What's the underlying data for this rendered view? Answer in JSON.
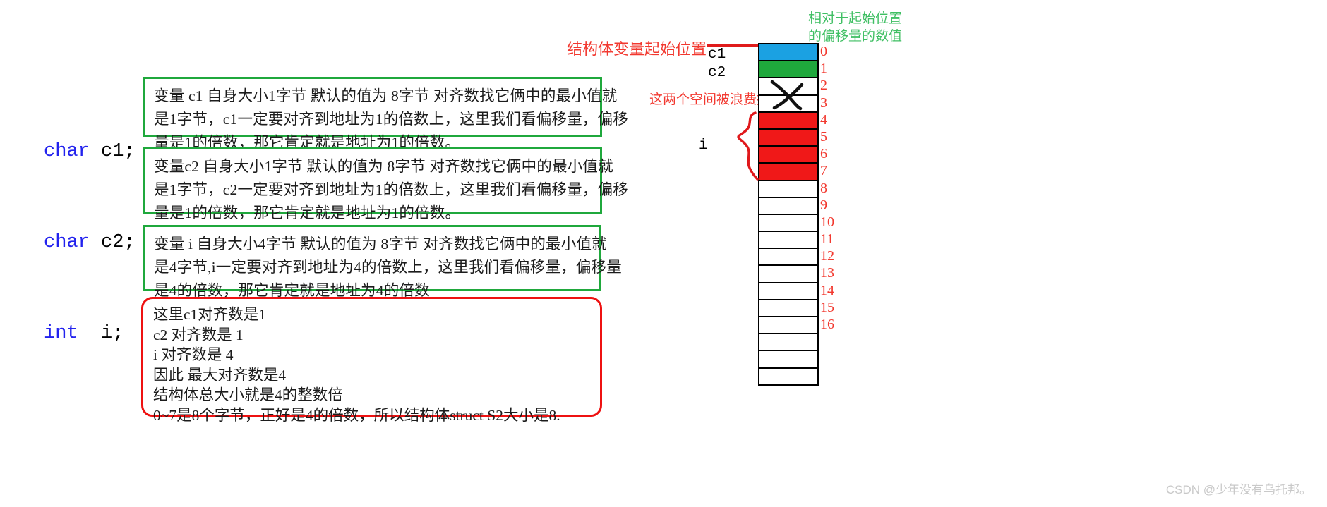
{
  "code": {
    "lines": [
      {
        "keyword": "char",
        "rest": " c1;"
      },
      {
        "keyword": "char",
        "rest": " c2;"
      },
      {
        "keyword": "int",
        "rest": "  i;"
      }
    ]
  },
  "green_boxes": [
    {
      "name": "explanation-c1",
      "lines": [
        "变量 c1 自身大小1字节 默认的值为 8字节 对齐数找它俩中的最小值就",
        "是1字节，c1一定要对齐到地址为1的倍数上，这里我们看偏移量，偏移",
        "量是1的倍数，那它肯定就是地址为1的倍数。"
      ]
    },
    {
      "name": "explanation-c2",
      "lines": [
        "变量c2 自身大小1字节 默认的值为 8字节 对齐数找它俩中的最小值就",
        "是1字节，c2一定要对齐到地址为1的倍数上，这里我们看偏移量，偏移",
        "量是1的倍数，那它肯定就是地址为1的倍数。"
      ]
    },
    {
      "name": "explanation-i",
      "lines": [
        "变量 i 自身大小4字节 默认的值为 8字节 对齐数找它俩中的最小值就",
        "是4字节,i一定要对齐到地址为4的倍数上，这里我们看偏移量，偏移量",
        "是4的倍数，那它肯定就是地址为4的倍数"
      ]
    }
  ],
  "red_box": {
    "name": "conclusion-box",
    "lines": [
      "这里c1对齐数是1",
      "c2 对齐数是 1",
      "i 对齐数是 4",
      "因此 最大对齐数是4",
      "结构体总大小就是4的整数倍",
      "0~7是8个字节，正好是4的倍数，所以结构体struct S2大小是8."
    ]
  },
  "annotations": {
    "start_position": "结构体变量起始位置",
    "wasted_space": "这两个空间被浪费掉了",
    "offset_legend": "相对于起始位置\n的偏移量的数值"
  },
  "variable_labels": {
    "c1": "c1",
    "c2": "c2",
    "i": "i"
  },
  "memory": {
    "offsets": [
      "0",
      "1",
      "2",
      "3",
      "4",
      "5",
      "6",
      "7",
      "8",
      "9",
      "10",
      "11",
      "12",
      "13",
      "14",
      "15",
      "16"
    ],
    "total_cells": 20,
    "cells": [
      {
        "offset": "0",
        "fill": "#1ba1e2",
        "owner": "c1"
      },
      {
        "offset": "1",
        "fill": "#1fa83c",
        "owner": "c2"
      },
      {
        "offset": "2",
        "fill": "#ffffff",
        "owner": "padding"
      },
      {
        "offset": "3",
        "fill": "#ffffff",
        "owner": "padding"
      },
      {
        "offset": "4",
        "fill": "#f01818",
        "owner": "i"
      },
      {
        "offset": "5",
        "fill": "#f01818",
        "owner": "i"
      },
      {
        "offset": "6",
        "fill": "#f01818",
        "owner": "i"
      },
      {
        "offset": "7",
        "fill": "#f01818",
        "owner": "i"
      },
      {
        "offset": "8",
        "fill": "#ffffff",
        "owner": ""
      },
      {
        "offset": "9",
        "fill": "#ffffff",
        "owner": ""
      },
      {
        "offset": "10",
        "fill": "#ffffff",
        "owner": ""
      },
      {
        "offset": "11",
        "fill": "#ffffff",
        "owner": ""
      },
      {
        "offset": "12",
        "fill": "#ffffff",
        "owner": ""
      },
      {
        "offset": "13",
        "fill": "#ffffff",
        "owner": ""
      },
      {
        "offset": "14",
        "fill": "#ffffff",
        "owner": ""
      },
      {
        "offset": "15",
        "fill": "#ffffff",
        "owner": ""
      },
      {
        "offset": "16",
        "fill": "#ffffff",
        "owner": ""
      },
      {
        "offset": "",
        "fill": "#ffffff",
        "owner": ""
      },
      {
        "offset": "",
        "fill": "#ffffff",
        "owner": ""
      },
      {
        "offset": "",
        "fill": "#ffffff",
        "owner": ""
      }
    ]
  },
  "colors": {
    "c1_cell": "#1ba1e2",
    "c2_cell": "#1fa83c",
    "i_cell": "#f01818",
    "offset_text": "#f2392f",
    "green_border": "#1fa83c",
    "red_border": "#ee1111",
    "legend_green": "#3fbf63",
    "keyword_blue": "#2222ee"
  },
  "watermark": "CSDN @少年没有乌托邦。"
}
